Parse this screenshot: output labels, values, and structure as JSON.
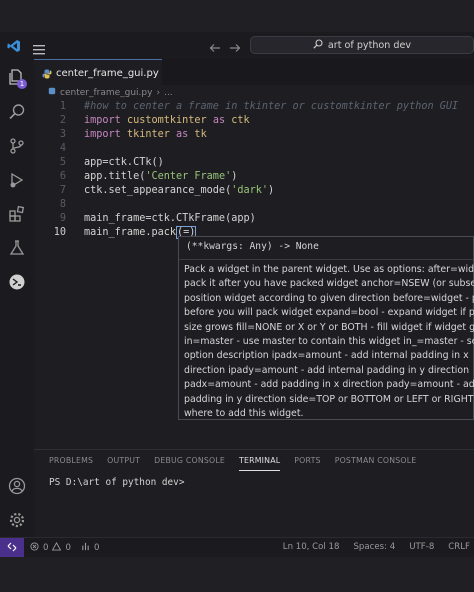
{
  "titlebar": {
    "search_text": "art of python dev"
  },
  "activity_bar": {
    "explorer_badge": "1"
  },
  "editor": {
    "tab": {
      "filename": "center_frame_gui.py"
    },
    "breadcrumb": {
      "file": "center_frame_gui.py",
      "sep": "›",
      "more": "..."
    },
    "active_line": 10,
    "lines": [
      {
        "n": "1",
        "tokens": [
          {
            "t": "#how to center a frame in tkinter or customtkinter python GUI",
            "c": "c-com"
          }
        ]
      },
      {
        "n": "2",
        "tokens": [
          {
            "t": "import",
            "c": "c-kw"
          },
          {
            "t": " customtkinter ",
            "c": "c-mod"
          },
          {
            "t": "as",
            "c": "c-kw"
          },
          {
            "t": " ctk",
            "c": "c-mod"
          }
        ]
      },
      {
        "n": "3",
        "tokens": [
          {
            "t": "import",
            "c": "c-kw"
          },
          {
            "t": " tkinter ",
            "c": "c-mod"
          },
          {
            "t": "as",
            "c": "c-kw"
          },
          {
            "t": " tk",
            "c": "c-mod"
          }
        ]
      },
      {
        "n": "4",
        "tokens": []
      },
      {
        "n": "5",
        "tokens": [
          {
            "t": "app=ctk.CTk()",
            "c": "c-plain"
          }
        ]
      },
      {
        "n": "6",
        "tokens": [
          {
            "t": "app.title(",
            "c": "c-plain"
          },
          {
            "t": "'Center Frame'",
            "c": "c-str"
          },
          {
            "t": ")",
            "c": "c-plain"
          }
        ]
      },
      {
        "n": "7",
        "tokens": [
          {
            "t": "ctk.set_appearance_mode(",
            "c": "c-plain"
          },
          {
            "t": "'dark'",
            "c": "c-str"
          },
          {
            "t": ")",
            "c": "c-plain"
          }
        ]
      },
      {
        "n": "8",
        "tokens": []
      },
      {
        "n": "9",
        "tokens": [
          {
            "t": "main_frame=ctk.CTkFrame(app)",
            "c": "c-plain"
          }
        ]
      },
      {
        "n": "10",
        "tokens": [
          {
            "t": "main_frame.pack",
            "c": "c-plain"
          },
          {
            "t": "(=)",
            "c": "cursorbox"
          }
        ]
      }
    ]
  },
  "hover": {
    "signature": "(**kwargs: Any) -> None",
    "doc_lines": [
      "Pack a widget in the parent widget. Use as options: after=widget -",
      "pack it after you have packed widget anchor=NSEW (or subset) -",
      "position widget according to given direction before=widget - pack",
      "before you will pack widget expand=bool - expand widget if parent",
      "size grows fill=NONE or X or Y or BOTH - fill widget if widget grows",
      "in=master - use master to contain this widget in_=master - see 'in'",
      "option description ipadx=amount - add internal padding in x",
      "direction ipady=amount - add internal padding in y direction",
      "padx=amount - add padding in x direction pady=amount - add",
      "padding in y direction side=TOP or BOTTOM or LEFT or RIGHT -",
      "where to add this widget."
    ]
  },
  "panel": {
    "tabs": [
      "PROBLEMS",
      "OUTPUT",
      "DEBUG CONSOLE",
      "TERMINAL",
      "PORTS",
      "POSTMAN CONSOLE"
    ],
    "active_tab": "TERMINAL",
    "terminal_prompt": "PS D:\\art of python dev>"
  },
  "statusbar": {
    "errors": "0",
    "warnings": "0",
    "ports": "0",
    "position": "Ln 10, Col 18",
    "spaces": "Spaces: 4",
    "encoding": "UTF-8",
    "eol": "CRLF"
  },
  "colors": {
    "accent": "#4a6fa5",
    "remote": "#4b2f8c",
    "badge": "#7b5bd6"
  }
}
